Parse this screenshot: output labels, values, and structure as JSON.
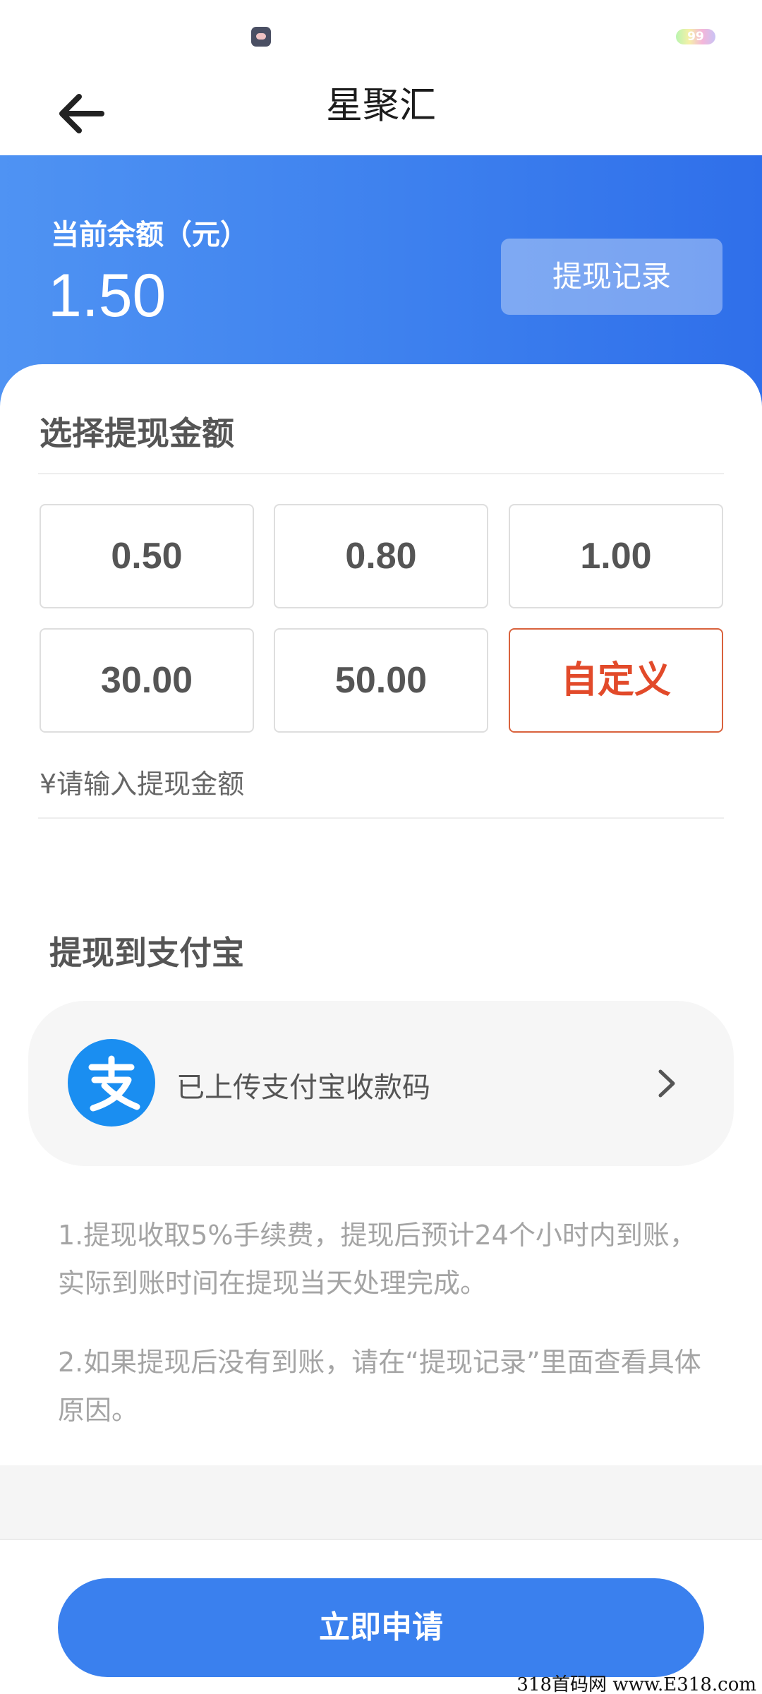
{
  "status_bar": {
    "battery_level": "99"
  },
  "nav": {
    "title": "星聚汇"
  },
  "balance": {
    "label": "当前余额（元）",
    "value": "1.50",
    "records_button": "提现记录"
  },
  "amount_section": {
    "title": "选择提现金额",
    "options": [
      {
        "label": "0.50",
        "selected": false
      },
      {
        "label": "0.80",
        "selected": false
      },
      {
        "label": "1.00",
        "selected": false
      },
      {
        "label": "30.00",
        "selected": false
      },
      {
        "label": "50.00",
        "selected": false
      },
      {
        "label": "自定义",
        "selected": true
      }
    ],
    "input_placeholder": "¥请输入提现金额",
    "input_value": ""
  },
  "alipay_section": {
    "title": "提现到支付宝",
    "status": "已上传支付宝收款码"
  },
  "notes": [
    "1.提现收取5%手续费，提现后预计24个小时内到账，实际到账时间在提现当天处理完成。",
    "2.如果提现后没有到账，请在“提现记录”里面查看具体原因。"
  ],
  "footer": {
    "apply_button": "立即申请"
  },
  "watermark": "318首码网 www.E318.com",
  "colors": {
    "primary_blue": "#3a80ee",
    "header_gradient_start": "#4f93f3",
    "header_gradient_end": "#2f6fea",
    "selected_red": "#e24a2a",
    "alipay_blue": "#1a8ef1"
  },
  "icons": {
    "back": "arrow-left-icon",
    "alipay": "alipay-logo-icon",
    "chevron": "chevron-right-icon"
  }
}
